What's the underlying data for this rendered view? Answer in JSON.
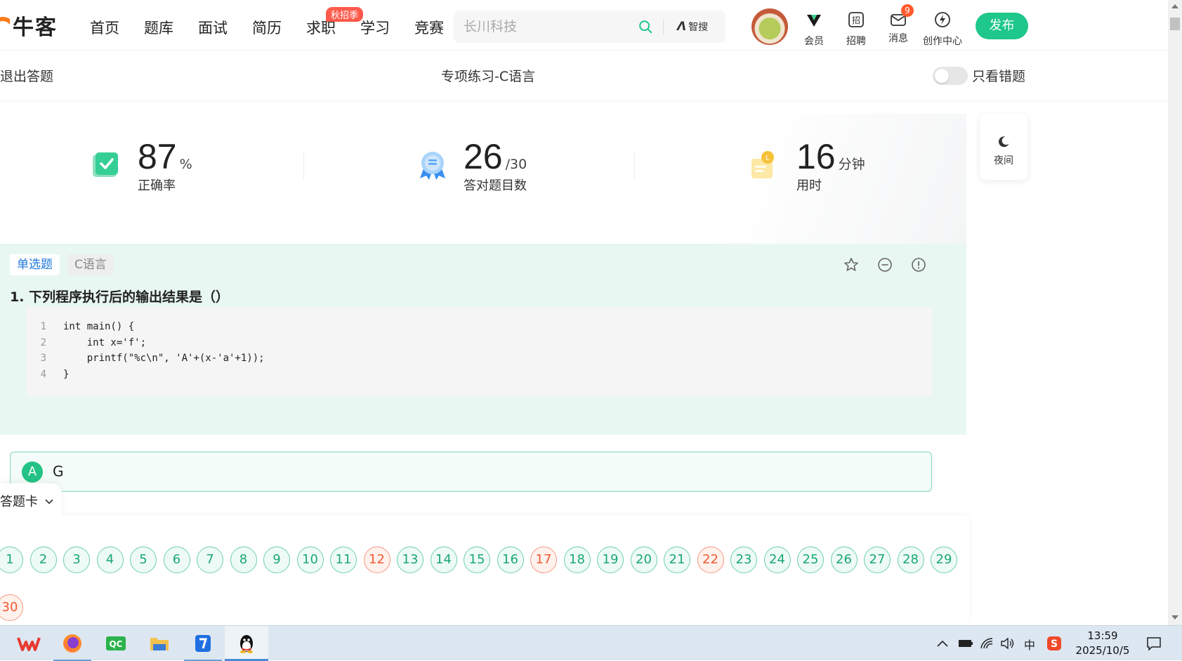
{
  "brand": {
    "name": "牛客",
    "accent": "#ff7a1a"
  },
  "nav": {
    "links": [
      "首页",
      "题库",
      "面试",
      "简历",
      "求职",
      "学习",
      "竞赛"
    ],
    "badge": "秋招季",
    "search_placeholder": "长川科技",
    "zhisou_label": "智搜"
  },
  "top_icons": {
    "member": "会员",
    "recruit": "招聘",
    "messages": "消息",
    "messages_count": "9",
    "creator": "创作中心",
    "publish": "发布"
  },
  "subheader": {
    "exit": "退出答题",
    "title": "专项练习-C语言",
    "wrong_only": "只看错题",
    "wrong_only_on": false
  },
  "stats": {
    "accuracy": {
      "value": "87",
      "unit": "%",
      "label": "正确率"
    },
    "correct": {
      "value": "26",
      "unit": "/30",
      "label": "答对题目数"
    },
    "time": {
      "value": "16",
      "unit": "分钟",
      "label": "用时"
    }
  },
  "night_mode": {
    "label": "夜间"
  },
  "question": {
    "type": "单选题",
    "subject": "C语言",
    "title": "1. 下列程序执行后的输出结果是（）",
    "code_lines": [
      {
        "no": "1",
        "text": "int main() {"
      },
      {
        "no": "2",
        "text": "    int x='f';"
      },
      {
        "no": "3",
        "text": "    printf(\"%c\\n\", 'A'+(x-'a'+1));"
      },
      {
        "no": "4",
        "text": "}"
      }
    ],
    "option": {
      "letter": "A",
      "text": "G"
    }
  },
  "answer_sheet": {
    "label": "答题卡",
    "numbers": [
      "1",
      "2",
      "3",
      "4",
      "5",
      "6",
      "7",
      "8",
      "9",
      "10",
      "11",
      "12",
      "13",
      "14",
      "15",
      "16",
      "17",
      "18",
      "19",
      "20",
      "21",
      "22",
      "23",
      "24",
      "25",
      "26",
      "27",
      "28",
      "29",
      "30"
    ],
    "wrong": [
      "12",
      "17",
      "22",
      "30"
    ]
  },
  "taskbar": {
    "tray": {
      "ime": "中"
    },
    "time": "13:59",
    "date": "2025/10/5"
  },
  "colors": {
    "green": "#1ec78a",
    "wrong": "#f05a33",
    "question_bg": "#e8f7f1"
  }
}
